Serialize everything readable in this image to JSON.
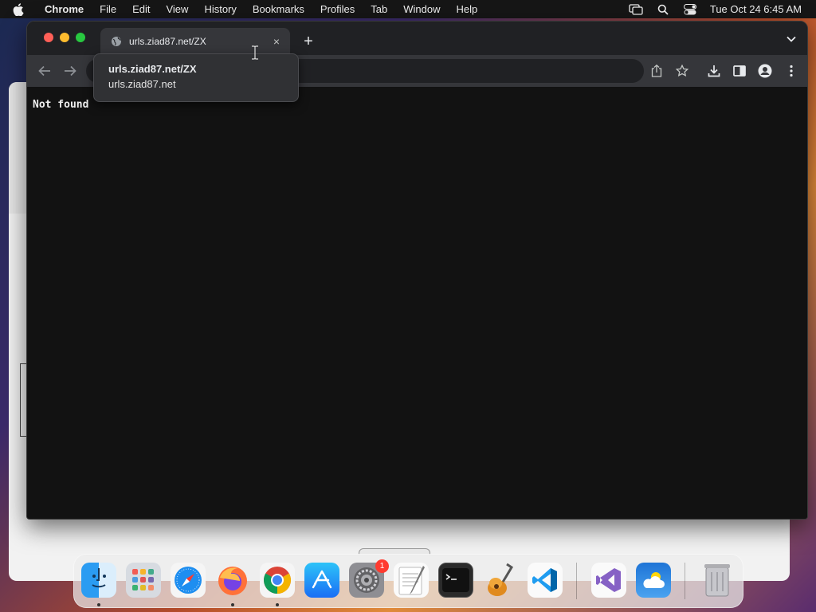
{
  "menubar": {
    "app_name": "Chrome",
    "items": [
      "File",
      "Edit",
      "View",
      "History",
      "Bookmarks",
      "Profiles",
      "Tab",
      "Window",
      "Help"
    ],
    "clock": "Tue Oct 24  6:45 AM"
  },
  "browser": {
    "tab_title": "urls.ziad87.net/ZX",
    "tab_close": "×",
    "new_tab": "+",
    "page_text": "Not found"
  },
  "hovercard": {
    "title": "urls.ziad87.net/ZX",
    "domain": "urls.ziad87.net"
  },
  "dock": {
    "apps": [
      "finder",
      "launchpad",
      "safari",
      "firefox",
      "chrome",
      "app-store",
      "system-settings",
      "textedit",
      "terminal",
      "garageband",
      "vscode",
      "visual-studio",
      "weather",
      "trash"
    ],
    "settings_badge": "1"
  },
  "colors": {
    "chrome_bg": "#121212",
    "tabstrip": "#202124",
    "toolbar": "#35363a",
    "close_red": "#ff5f57",
    "minimize_yellow": "#febc2e",
    "maximize_green": "#28c840"
  }
}
